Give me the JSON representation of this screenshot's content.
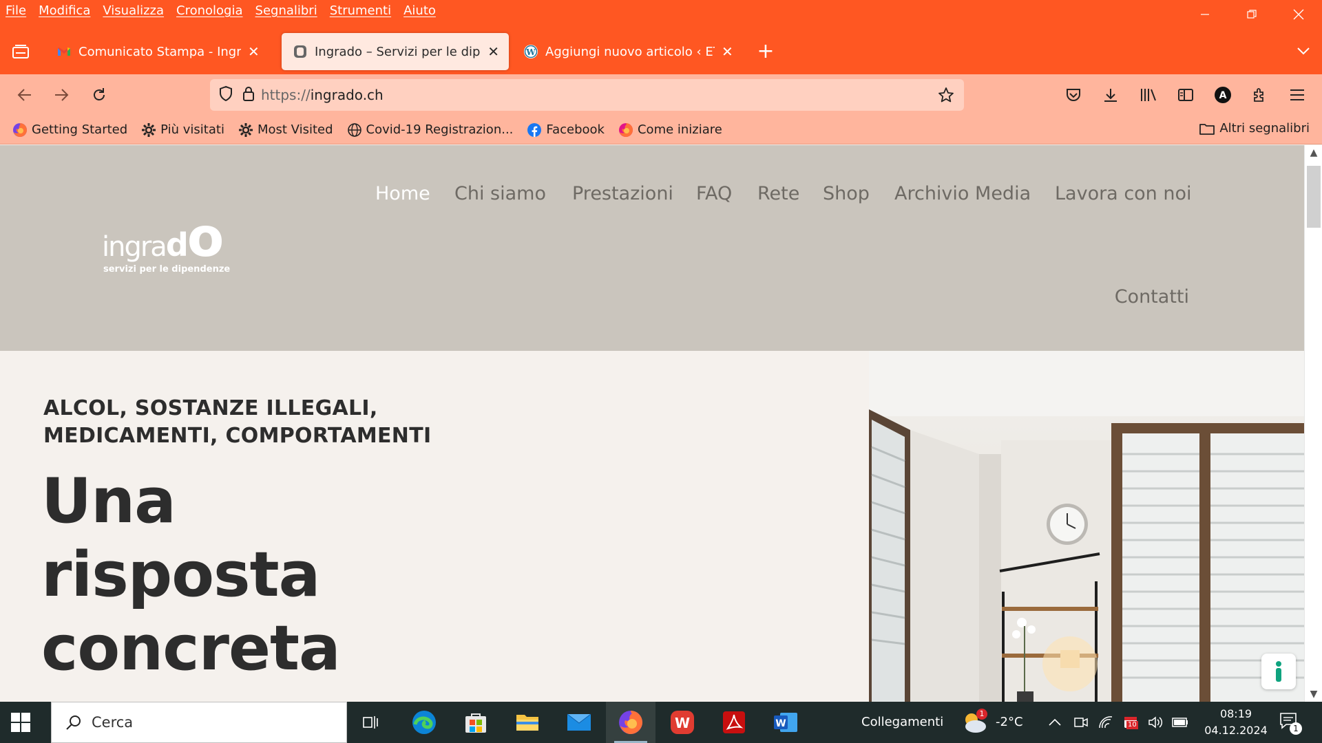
{
  "menu": [
    "File",
    "Modifica",
    "Visualizza",
    "Cronologia",
    "Segnalibri",
    "Strumenti",
    "Aiuto"
  ],
  "tabs": [
    {
      "title": "Comunicato Stampa - Ingrado",
      "favicon": "gmail-icon"
    },
    {
      "title": "Ingrado – Servizi per le dipendenze",
      "favicon": "site-icon",
      "active": true
    },
    {
      "title": "Aggiungi nuovo articolo ‹ ETiCi",
      "favicon": "wordpress-icon"
    }
  ],
  "url": {
    "protocol": "https://",
    "host": "ingrado.ch"
  },
  "bookmarks": [
    {
      "label": "Getting Started",
      "icon": "firefox-icon"
    },
    {
      "label": "Più visitati",
      "icon": "gear-icon"
    },
    {
      "label": "Most Visited",
      "icon": "gear-icon"
    },
    {
      "label": "Covid-19 Registrazion...",
      "icon": "globe-icon"
    },
    {
      "label": "Facebook",
      "icon": "facebook-icon"
    },
    {
      "label": "Come iniziare",
      "icon": "firefox-icon"
    }
  ],
  "other_bookmarks": "Altri segnalibri",
  "site": {
    "logo_word_light": "in",
    "logo_word_mid": "gra",
    "logo_word_end": "d",
    "logo_word_o": "o",
    "logo_tagline": "servizi per le dipendenze",
    "nav": [
      "Home",
      "Chi siamo",
      "Prestazioni",
      "FAQ",
      "Rete",
      "Shop",
      "Archivio Media",
      "Lavora con noi"
    ],
    "nav_active": "Home",
    "nav_second_row": "Contatti",
    "kicker_line1": "ALCOL, SOSTANZE ILLEGALI,",
    "kicker_line2": "MEDICAMENTI, COMPORTAMENTI",
    "headline_line1": "Una",
    "headline_line2": "risposta",
    "headline_line3": "concreta"
  },
  "taskbar": {
    "search_placeholder": "Cerca",
    "links_label": "Collegamenti",
    "weather_badge": "1",
    "temperature": "-2°C",
    "battery_badge": "10",
    "time": "08:19",
    "date": "04.12.2024",
    "notification_count": "1"
  },
  "colors": {
    "firefox_frame": "#ff5722",
    "toolbar": "#ffb59d",
    "header_bg": "#cac5bd",
    "hero_bg": "#f5f1ed",
    "text_dark": "#2d2d2d"
  }
}
